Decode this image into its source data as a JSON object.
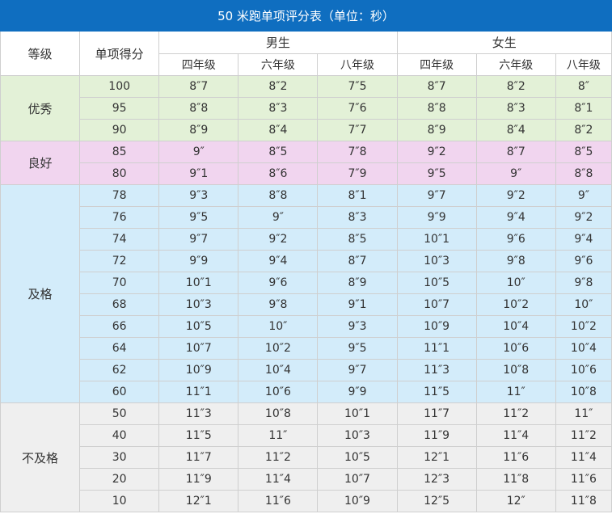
{
  "title": "50 米跑单项评分表（单位：秒）",
  "headers": {
    "grade": "等级",
    "score": "单项得分",
    "male": "男生",
    "female": "女生",
    "grade4": "四年级",
    "grade6": "六年级",
    "grade8": "八年级"
  },
  "colors": {
    "title_bg": "#0f6ec0",
    "excellent_bg": "#e3f1d7",
    "good_bg": "#f1d5ef",
    "pass_bg": "#d3ecfa",
    "fail_bg": "#efefef"
  },
  "groups": [
    {
      "key": "excellent",
      "label": "优秀",
      "rows": [
        {
          "score": "100",
          "m4": "8″7",
          "m6": "8″2",
          "m8": "7″5",
          "f4": "8″7",
          "f6": "8″2",
          "f8": "8″"
        },
        {
          "score": "95",
          "m4": "8″8",
          "m6": "8″3",
          "m8": "7″6",
          "f4": "8″8",
          "f6": "8″3",
          "f8": "8″1"
        },
        {
          "score": "90",
          "m4": "8″9",
          "m6": "8″4",
          "m8": "7″7",
          "f4": "8″9",
          "f6": "8″4",
          "f8": "8″2"
        }
      ]
    },
    {
      "key": "good",
      "label": "良好",
      "rows": [
        {
          "score": "85",
          "m4": "9″",
          "m6": "8″5",
          "m8": "7″8",
          "f4": "9″2",
          "f6": "8″7",
          "f8": "8″5"
        },
        {
          "score": "80",
          "m4": "9″1",
          "m6": "8″6",
          "m8": "7″9",
          "f4": "9″5",
          "f6": "9″",
          "f8": "8″8"
        }
      ]
    },
    {
      "key": "pass",
      "label": "及格",
      "rows": [
        {
          "score": "78",
          "m4": "9″3",
          "m6": "8″8",
          "m8": "8″1",
          "f4": "9″7",
          "f6": "9″2",
          "f8": "9″"
        },
        {
          "score": "76",
          "m4": "9″5",
          "m6": "9″",
          "m8": "8″3",
          "f4": "9″9",
          "f6": "9″4",
          "f8": "9″2"
        },
        {
          "score": "74",
          "m4": "9″7",
          "m6": "9″2",
          "m8": "8″5",
          "f4": "10″1",
          "f6": "9″6",
          "f8": "9″4"
        },
        {
          "score": "72",
          "m4": "9″9",
          "m6": "9″4",
          "m8": "8″7",
          "f4": "10″3",
          "f6": "9″8",
          "f8": "9″6"
        },
        {
          "score": "70",
          "m4": "10″1",
          "m6": "9″6",
          "m8": "8″9",
          "f4": "10″5",
          "f6": "10″",
          "f8": "9″8"
        },
        {
          "score": "68",
          "m4": "10″3",
          "m6": "9″8",
          "m8": "9″1",
          "f4": "10″7",
          "f6": "10″2",
          "f8": "10″"
        },
        {
          "score": "66",
          "m4": "10″5",
          "m6": "10″",
          "m8": "9″3",
          "f4": "10″9",
          "f6": "10″4",
          "f8": "10″2"
        },
        {
          "score": "64",
          "m4": "10″7",
          "m6": "10″2",
          "m8": "9″5",
          "f4": "11″1",
          "f6": "10″6",
          "f8": "10″4"
        },
        {
          "score": "62",
          "m4": "10″9",
          "m6": "10″4",
          "m8": "9″7",
          "f4": "11″3",
          "f6": "10″8",
          "f8": "10″6"
        },
        {
          "score": "60",
          "m4": "11″1",
          "m6": "10″6",
          "m8": "9″9",
          "f4": "11″5",
          "f6": "11″",
          "f8": "10″8"
        }
      ]
    },
    {
      "key": "fail",
      "label": "不及格",
      "rows": [
        {
          "score": "50",
          "m4": "11″3",
          "m6": "10″8",
          "m8": "10″1",
          "f4": "11″7",
          "f6": "11″2",
          "f8": "11″"
        },
        {
          "score": "40",
          "m4": "11″5",
          "m6": "11″",
          "m8": "10″3",
          "f4": "11″9",
          "f6": "11″4",
          "f8": "11″2"
        },
        {
          "score": "30",
          "m4": "11″7",
          "m6": "11″2",
          "m8": "10″5",
          "f4": "12″1",
          "f6": "11″6",
          "f8": "11″4"
        },
        {
          "score": "20",
          "m4": "11″9",
          "m6": "11″4",
          "m8": "10″7",
          "f4": "12″3",
          "f6": "11″8",
          "f8": "11″6"
        },
        {
          "score": "10",
          "m4": "12″1",
          "m6": "11″6",
          "m8": "10″9",
          "f4": "12″5",
          "f6": "12″",
          "f8": "11″8"
        }
      ]
    }
  ]
}
